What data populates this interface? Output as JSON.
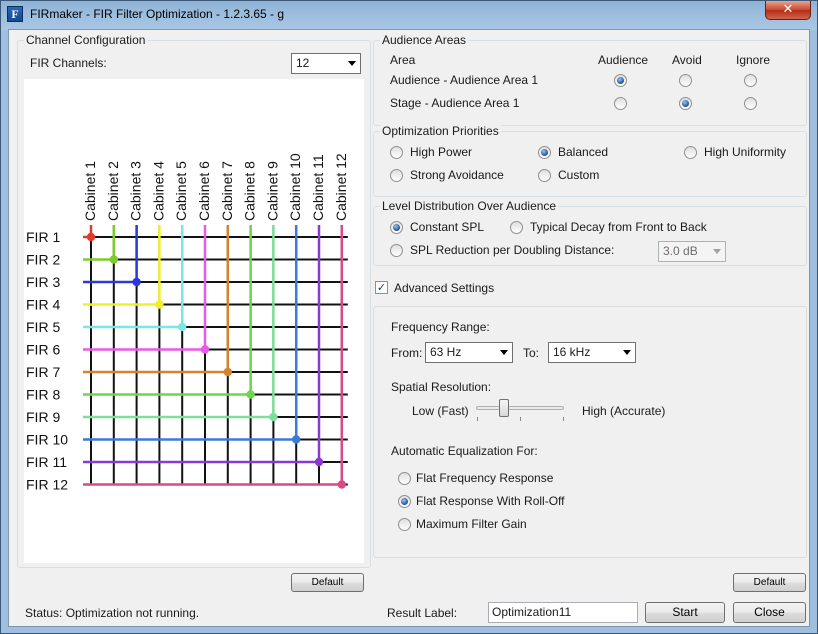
{
  "window": {
    "title": "FIRmaker - FIR Filter Optimization - 1.2.3.65 - g",
    "app_icon_glyph": "F",
    "close_glyph": "✕"
  },
  "channel_config": {
    "title": "Channel Configuration",
    "fir_channels_label": "FIR Channels:",
    "fir_channels_value": "12",
    "cabinets": [
      "Cabinet 1",
      "Cabinet 2",
      "Cabinet 3",
      "Cabinet 4",
      "Cabinet 5",
      "Cabinet 6",
      "Cabinet 7",
      "Cabinet 8",
      "Cabinet 9",
      "Cabinet 10",
      "Cabinet 11",
      "Cabinet 12"
    ],
    "firs": [
      "FIR 1",
      "FIR 2",
      "FIR 3",
      "FIR 4",
      "FIR 5",
      "FIR 6",
      "FIR 7",
      "FIR 8",
      "FIR 9",
      "FIR 10",
      "FIR 11",
      "FIR 12"
    ],
    "colors": [
      "#e23a2a",
      "#7ccc2e",
      "#2a39d8",
      "#f0f02a",
      "#7ae6e6",
      "#e85ae8",
      "#d9822e",
      "#6ad84a",
      "#7ce09a",
      "#3a7ad8",
      "#8a3ad2",
      "#d84a8a"
    ],
    "default_button": "Default"
  },
  "audience_areas": {
    "title": "Audience Areas",
    "headers": {
      "area": "Area",
      "audience": "Audience",
      "avoid": "Avoid",
      "ignore": "Ignore"
    },
    "rows": [
      {
        "name": "Audience - Audience Area 1",
        "selected": "audience"
      },
      {
        "name": "Stage - Audience Area 1",
        "selected": "avoid"
      }
    ]
  },
  "optimization_priorities": {
    "title": "Optimization Priorities",
    "options": [
      "High Power",
      "Balanced",
      "High Uniformity",
      "Strong Avoidance",
      "Custom"
    ],
    "selected": "Balanced"
  },
  "level_distribution": {
    "title": "Level Distribution Over Audience",
    "constant_spl": "Constant SPL",
    "typical_decay": "Typical Decay from Front to Back",
    "spl_reduction": "SPL Reduction per Doubling Distance:",
    "spl_reduction_value": "3.0 dB",
    "selected": "Constant SPL"
  },
  "advanced": {
    "checkbox_label": "Advanced Settings",
    "checked": true,
    "check_glyph": "✓",
    "frequency_range_label": "Frequency Range:",
    "from_label": "From:",
    "from_value": "63 Hz",
    "to_label": "To:",
    "to_value": "16 kHz",
    "spatial_resolution_label": "Spatial Resolution:",
    "low_label": "Low (Fast)",
    "high_label": "High (Accurate)",
    "slider_fraction": 0.27,
    "auto_eq_label": "Automatic Equalization For:",
    "eq_options": [
      "Flat Frequency Response",
      "Flat Response With Roll-Off",
      "Maximum Filter Gain"
    ],
    "eq_selected": "Flat Response With Roll-Off",
    "default_button": "Default"
  },
  "status_bar": {
    "status_text": "Status: Optimization not running.",
    "result_label": "Result Label:",
    "result_value": "Optimization11",
    "start_button": "Start",
    "close_button": "Close"
  }
}
